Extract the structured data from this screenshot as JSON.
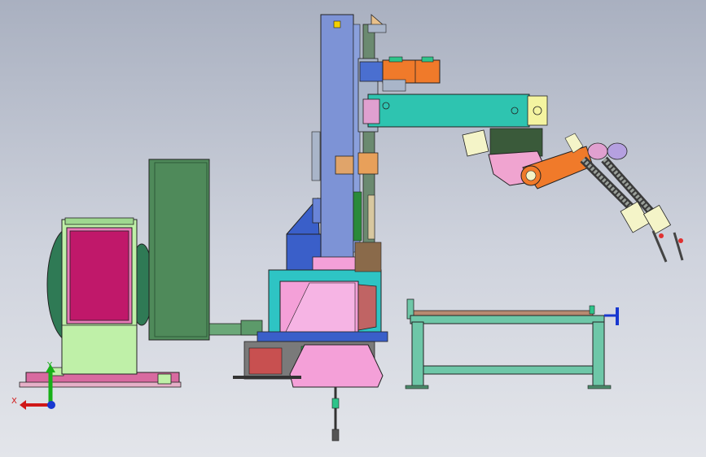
{
  "viewport": {
    "background_top": "#a9b0c0",
    "background_bottom": "#e3e5ea"
  },
  "colors": {
    "column": "#7d93d6",
    "arm": "#2ec4b0",
    "motor": "#f07a2a",
    "positioner_panel": "#c0186a",
    "positioner_body": "#bff0a8",
    "cabinet": "#4f8a5a",
    "base_pink": "#f4a0d8",
    "cone": "#3a5fc9",
    "table_frame": "#6ec7a8",
    "axis_x": "#d01818",
    "axis_y": "#18b018",
    "axis_z": "#1838d0"
  },
  "triad": {
    "x_label": "X",
    "y_label": "Y"
  }
}
